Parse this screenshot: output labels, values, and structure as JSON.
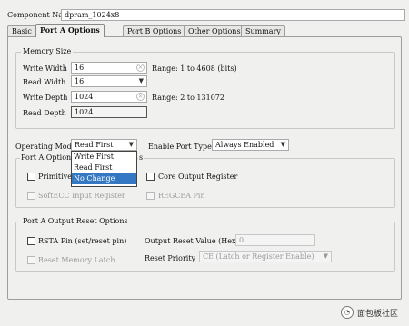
{
  "component": {
    "name_label": "Component Name",
    "name_value": "dpram_1024x8"
  },
  "tabs": [
    "Basic",
    "Port A Options",
    "Port B Options",
    "Other Options",
    "Summary"
  ],
  "memory_size": {
    "title": "Memory Size",
    "write_width": {
      "label": "Write Width",
      "value": "16",
      "range": "Range: 1 to 4608 (bits)"
    },
    "read_width": {
      "label": "Read Width",
      "value": "16"
    },
    "write_depth": {
      "label": "Write Depth",
      "value": "1024",
      "range": "Range: 2 to 131072"
    },
    "read_depth": {
      "label": "Read Depth",
      "value": "1024"
    }
  },
  "operating_mode": {
    "label": "Operating Mode",
    "value": "Read First",
    "options": [
      "Write First",
      "Read First",
      "No Change"
    ],
    "highlighted": "No Change"
  },
  "enable_port_type": {
    "label": "Enable Port Type",
    "value": "Always Enabled"
  },
  "port_a_optional": {
    "title_left": "Port A Option",
    "title_right": "s",
    "primitives_label": "Primitive",
    "core_output_label": "Core Output Register",
    "softecc_label": "SoftECC Input Register",
    "regcea_label": "REGCEA Pin"
  },
  "port_a_reset": {
    "title": "Port A Output Reset Options",
    "rsta_label": "RSTA Pin (set/reset pin)",
    "output_reset_label": "Output Reset Value (Hex)",
    "output_reset_value": "0",
    "reset_memory_latch_label": "Reset Memory Latch",
    "reset_priority_label": "Reset Priority",
    "reset_priority_value": "CE (Latch or Register Enable)"
  },
  "watermark": {
    "text": "面包板社区"
  },
  "icons": {
    "clear": "clear-circle-icon",
    "dropdown": "chevron-down-icon"
  }
}
